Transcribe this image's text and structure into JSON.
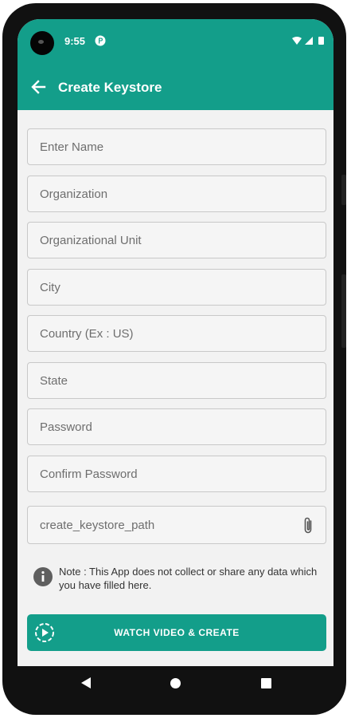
{
  "status_bar": {
    "time": "9:55"
  },
  "app_bar": {
    "title": "Create Keystore"
  },
  "form": {
    "fields": [
      {
        "placeholder": "Enter Name"
      },
      {
        "placeholder": "Organization"
      },
      {
        "placeholder": "Organizational Unit"
      },
      {
        "placeholder": "City"
      },
      {
        "placeholder": "Country (Ex : US)"
      },
      {
        "placeholder": "State"
      },
      {
        "placeholder": "Password"
      },
      {
        "placeholder": "Confirm Password"
      }
    ],
    "path_text": "create_keystore_path"
  },
  "note": {
    "text": "Note : This App does not collect or share any data which you have filled here."
  },
  "watch_button": {
    "label": "WATCH VIDEO & CREATE"
  },
  "colors": {
    "primary": "#139e8a",
    "background": "#f2f2f2"
  },
  "icons": {
    "back": "arrow-left-icon",
    "attach": "paperclip-icon",
    "info": "info-icon",
    "play": "play-circle-icon"
  }
}
